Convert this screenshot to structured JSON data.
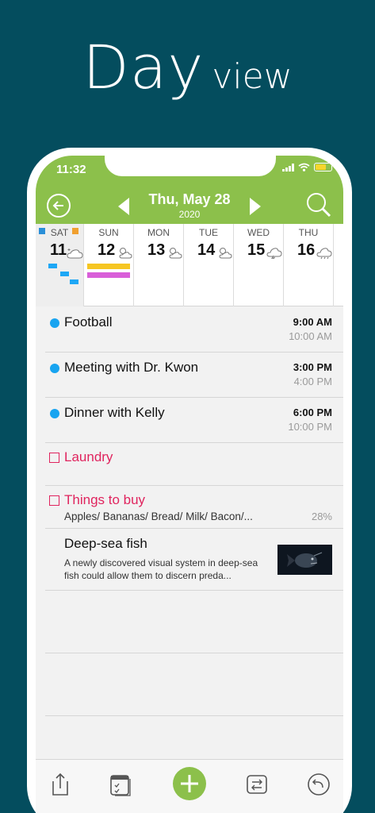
{
  "promo": {
    "title_big": "Day",
    "title_small": "view"
  },
  "status_bar": {
    "time": "11:32"
  },
  "header": {
    "date": "Thu, May 28",
    "year": "2020"
  },
  "week": [
    {
      "name": "SAT",
      "num": "11",
      "selected": true,
      "weather": "partly-cloudy-night-icon"
    },
    {
      "name": "SUN",
      "num": "12",
      "weather": "partly-cloudy-icon"
    },
    {
      "name": "MON",
      "num": "13",
      "weather": "partly-cloudy-icon"
    },
    {
      "name": "TUE",
      "num": "14",
      "weather": "partly-cloudy-icon"
    },
    {
      "name": "WED",
      "num": "15",
      "weather": "thunderstorm-icon"
    },
    {
      "name": "THU",
      "num": "16",
      "weather": "rain-icon"
    }
  ],
  "events": [
    {
      "title": "Football",
      "start": "9:00 AM",
      "end": "10:00 AM",
      "color": "#18a4f0"
    },
    {
      "title": "Meeting with Dr. Kwon",
      "start": "3:00 PM",
      "end": "4:00 PM",
      "color": "#18a4f0"
    },
    {
      "title": "Dinner with Kelly",
      "start": "6:00 PM",
      "end": "10:00 PM",
      "color": "#18a4f0"
    }
  ],
  "todos": [
    {
      "title": "Laundry"
    },
    {
      "title": "Things to buy",
      "items": "Apples/ Bananas/ Bread/ Milk/ Bacon/...",
      "progress": "28%"
    }
  ],
  "memo": {
    "title": "Deep-sea fish",
    "body": "A newly discovered visual system in deep-sea fish could allow them to discern preda..."
  },
  "colors": {
    "accent": "#8cc04b",
    "background": "#044d5e",
    "todo": "#e0245e",
    "event_dot": "#18a4f0"
  },
  "toolbar": [
    "share-icon",
    "calendar-list-icon",
    "add-icon",
    "swap-icon",
    "undo-icon"
  ]
}
